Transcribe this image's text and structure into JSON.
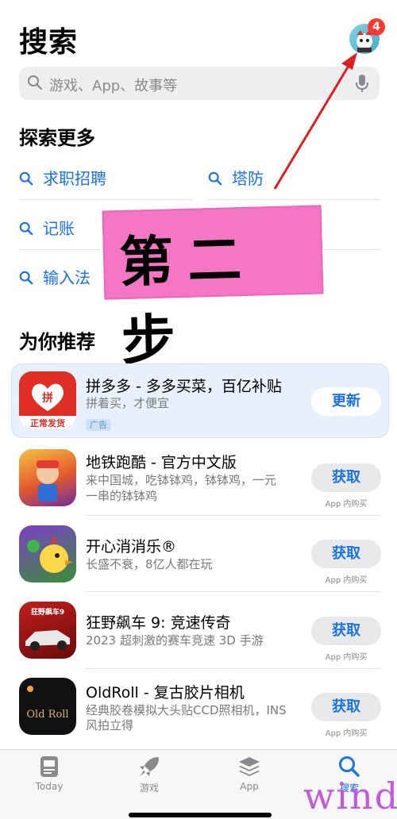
{
  "header": {
    "title": "搜索",
    "badge_count": "4"
  },
  "search": {
    "placeholder": "游戏、App、故事等"
  },
  "explore": {
    "heading": "探索更多",
    "keywords": [
      "求职招聘",
      "塔防",
      "记账",
      "输入法"
    ]
  },
  "banner": {
    "text": "第二步"
  },
  "recommend": {
    "heading": "为你推荐",
    "featured": {
      "name": "拼多多 - 多多买菜，百亿补贴",
      "subtitle": "拼着买，才便宜",
      "ad_label": "广告",
      "button": "更新",
      "icon_caption": "正常发货",
      "icon_text": "拼"
    },
    "apps": [
      {
        "name": "地铁跑酷 - 官方中文版",
        "line1": "来中国城，吃钵钵鸡，钵钵鸡，一元",
        "line2": "一串的钵钵鸡",
        "button": "获取",
        "iap": "App 内购买"
      },
      {
        "name": "开心消消乐®",
        "line1": "长盛不衰，8亿人都在玩",
        "line2": "",
        "button": "获取",
        "iap": "App 内购买"
      },
      {
        "name": "狂野飙车 9: 竞速传奇",
        "line1": "2023 超刺激的赛车竞速 3D 手游",
        "line2": "",
        "button": "获取",
        "iap": "App 内购买",
        "icon_text": "狂野飙车9"
      },
      {
        "name": "OldRoll - 复古胶片相机",
        "line1": "经典胶卷模拟大头贴CCD照相机，INS",
        "line2": "风拍立得",
        "button": "获取",
        "iap": "App 内购买",
        "icon_text": "Old Roll"
      }
    ]
  },
  "tabbar": {
    "items": [
      {
        "label": "Today",
        "icon": "today-icon"
      },
      {
        "label": "游戏",
        "icon": "rocket-icon"
      },
      {
        "label": "App",
        "icon": "layers-icon"
      },
      {
        "label": "搜索",
        "icon": "search-icon"
      }
    ]
  },
  "watermark": "wind",
  "colors": {
    "accent": "#1a73e8",
    "badge": "#ff3b30",
    "banner": "#f676c6",
    "arrow": "#e02020"
  }
}
